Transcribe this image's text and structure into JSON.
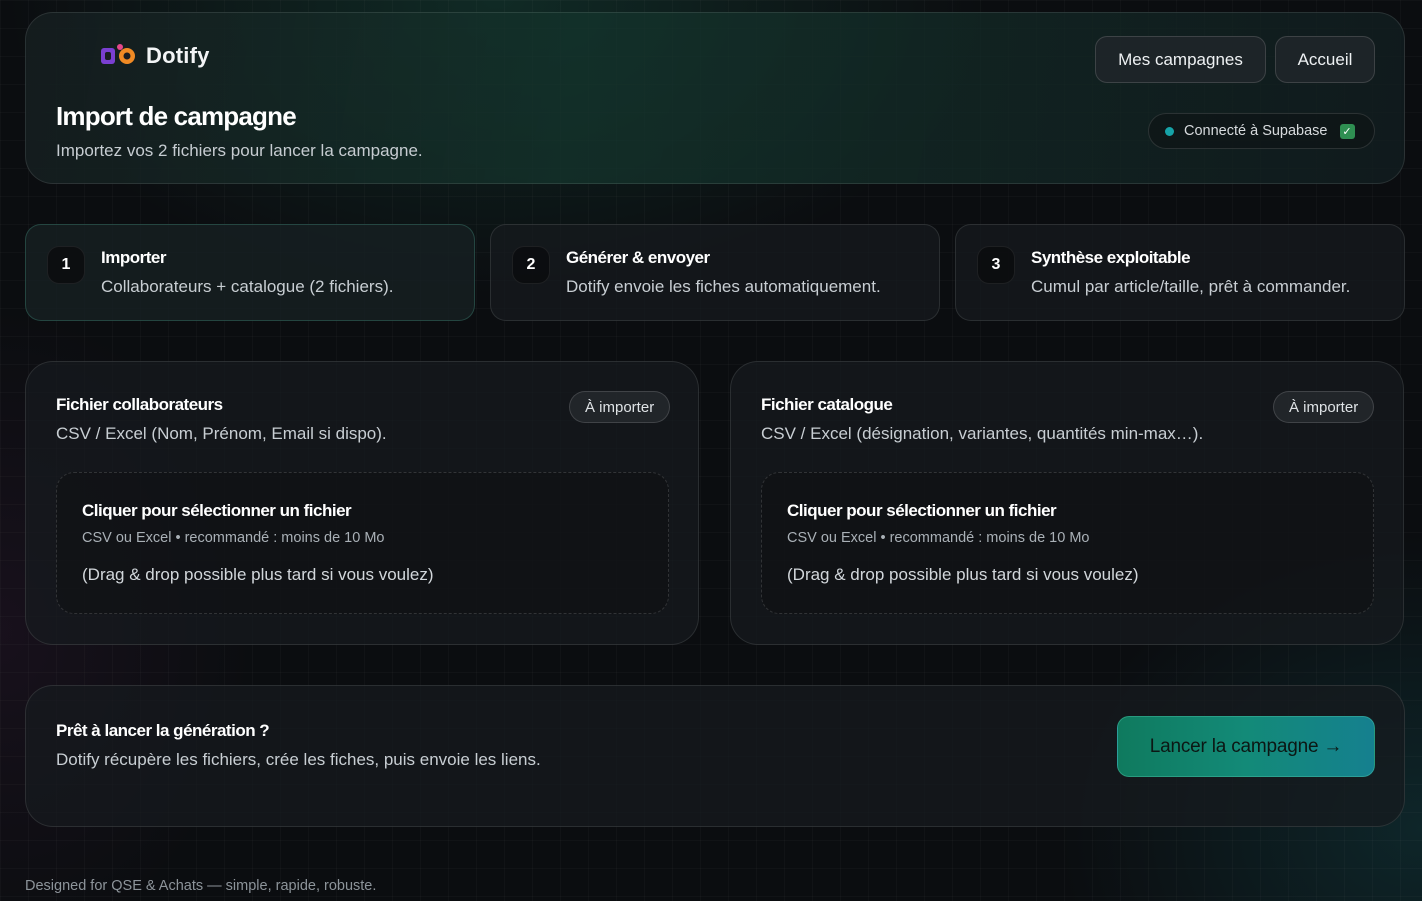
{
  "brand": {
    "name": "Dotify"
  },
  "header": {
    "title": "Import de campagne",
    "subtitle": "Importez vos 2 fichiers pour lancer la campagne.",
    "nav": {
      "campaigns_label": "Mes campagnes",
      "home_label": "Accueil"
    },
    "status": {
      "label": "Connecté à Supabase",
      "check": "✓"
    }
  },
  "steps": [
    {
      "number": "1",
      "title": "Importer",
      "description": "Collaborateurs + catalogue (2 fichiers)."
    },
    {
      "number": "2",
      "title": "Générer & envoyer",
      "description": "Dotify envoie les fiches automatiquement."
    },
    {
      "number": "3",
      "title": "Synthèse exploitable",
      "description": "Cumul par article/taille, prêt à commander."
    }
  ],
  "files": [
    {
      "title": "Fichier collaborateurs",
      "description": "CSV / Excel (Nom, Prénom, Email si dispo).",
      "badge": "À importer",
      "dropzone": {
        "title": "Cliquer pour sélectionner un fichier",
        "hint": "CSV ou Excel • recommandé : moins de 10 Mo",
        "note": "(Drag & drop possible plus tard si vous voulez)"
      }
    },
    {
      "title": "Fichier catalogue",
      "description": "CSV / Excel (désignation, variantes, quantités min-max…).",
      "badge": "À importer",
      "dropzone": {
        "title": "Cliquer pour sélectionner un fichier",
        "hint": "CSV ou Excel • recommandé : moins de 10 Mo",
        "note": "(Drag & drop possible plus tard si vous voulez)"
      }
    }
  ],
  "launch": {
    "title": "Prêt à lancer la génération ?",
    "description": "Dotify récupère les fichiers, crée les fiches, puis envoie les liens.",
    "button_label": "Lancer la campagne →"
  },
  "footer": {
    "text": "Designed for QSE & Achats — simple, rapide, robuste."
  },
  "colors": {
    "accent": "#138a78",
    "status_dot": "#16a3a8",
    "check": "#2f8f52"
  },
  "icons": {
    "logo": "dotify-logo-icon",
    "status": "status-dot-icon",
    "check": "checkbox-checked-icon"
  }
}
